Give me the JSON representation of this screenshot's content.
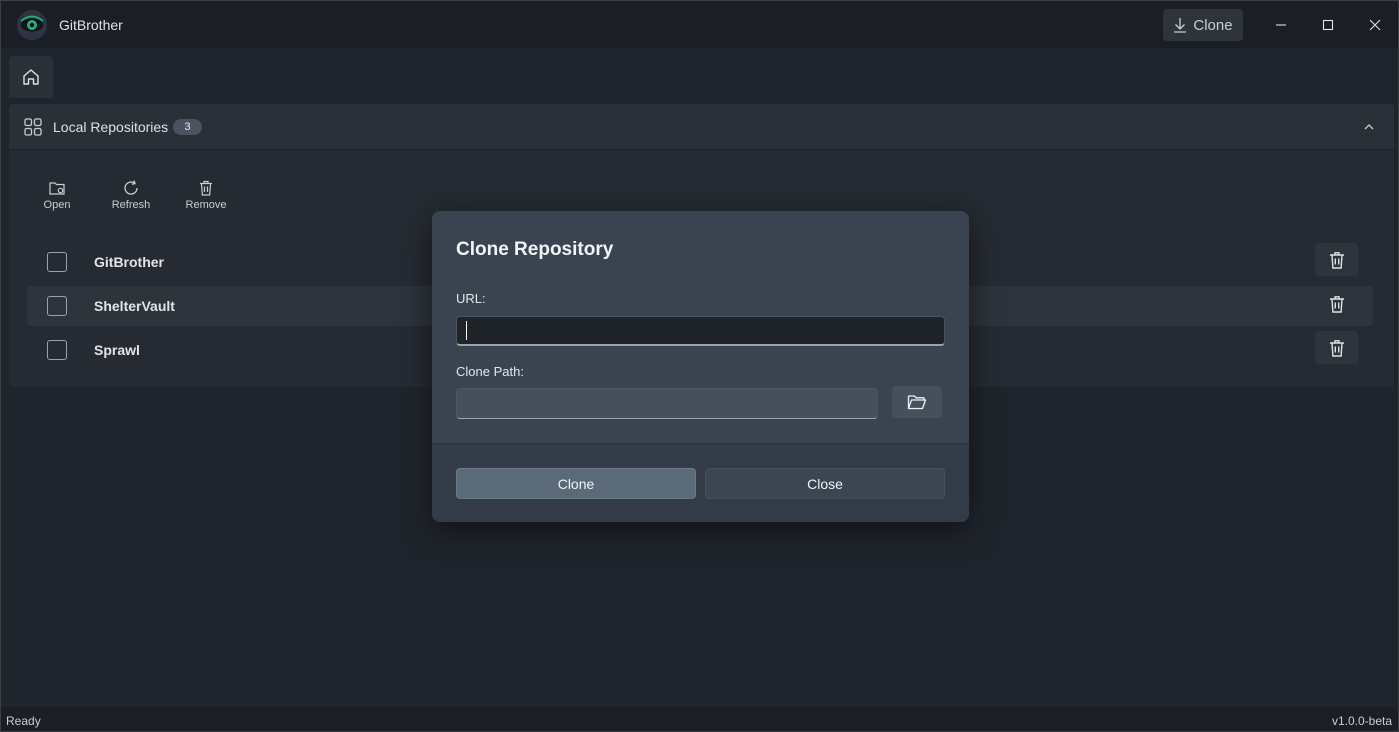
{
  "app": {
    "title": "GitBrother"
  },
  "titlebar": {
    "clone_label": "Clone"
  },
  "section": {
    "title": "Local Repositories",
    "count": "3"
  },
  "toolbar": {
    "open_label": "Open",
    "refresh_label": "Refresh",
    "remove_label": "Remove"
  },
  "repos": [
    {
      "name": "GitBrother"
    },
    {
      "name": "ShelterVault"
    },
    {
      "name": "Sprawl"
    }
  ],
  "dialog": {
    "title": "Clone Repository",
    "url_label": "URL:",
    "url_value": "",
    "path_label": "Clone Path:",
    "path_value": "",
    "clone_label": "Clone",
    "close_label": "Close"
  },
  "status": {
    "left": "Ready",
    "right": "v1.0.0-beta"
  },
  "colors": {
    "background": "#20252d",
    "dialog": "#3a4450",
    "primary_button": "#5a6a78"
  }
}
